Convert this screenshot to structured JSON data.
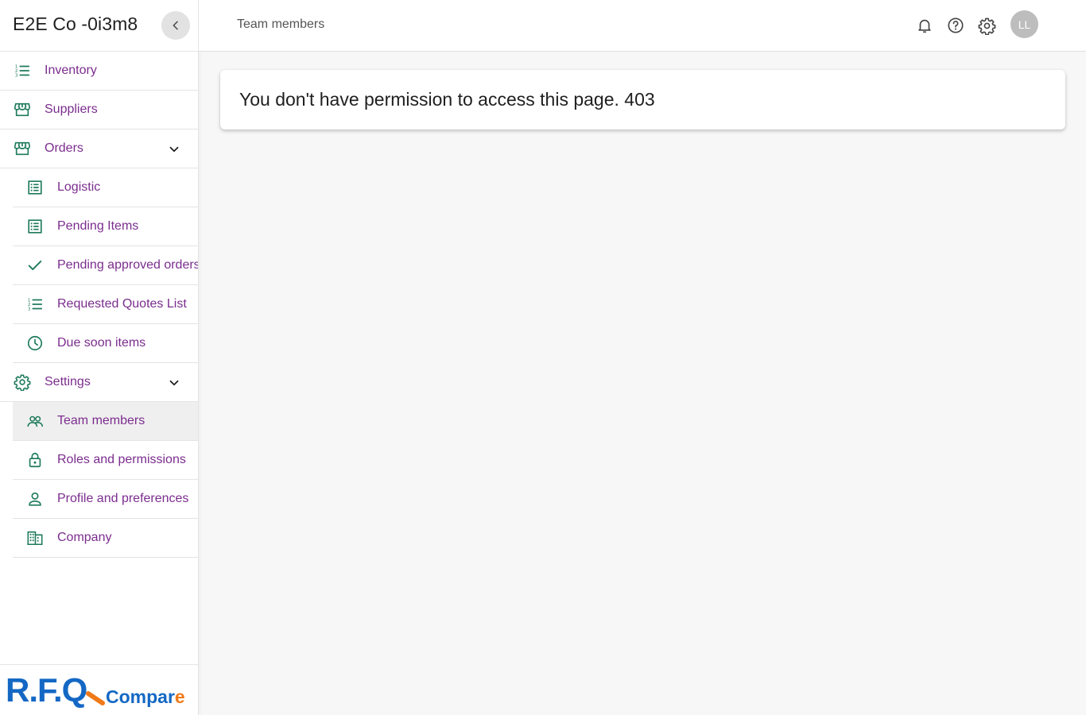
{
  "sidebar": {
    "company_name": "E2E Co -0i3m8",
    "items": [
      {
        "label": "Inventory",
        "icon": "list-numbered-icon"
      },
      {
        "label": "Suppliers",
        "icon": "storefront-icon"
      },
      {
        "label": "Orders",
        "icon": "storefront-icon",
        "expanded": true
      },
      {
        "label": "Logistic",
        "icon": "receipt-list-icon"
      },
      {
        "label": "Pending Items",
        "icon": "receipt-list-icon"
      },
      {
        "label": "Pending approved orders",
        "icon": "check-icon"
      },
      {
        "label": "Requested Quotes List",
        "icon": "list-numbered-icon"
      },
      {
        "label": "Due soon items",
        "icon": "clock-icon"
      },
      {
        "label": "Settings",
        "icon": "gear-icon",
        "expanded": true
      },
      {
        "label": "Team members",
        "icon": "people-icon",
        "active": true
      },
      {
        "label": "Roles and permissions",
        "icon": "lock-icon"
      },
      {
        "label": "Profile and preferences",
        "icon": "person-icon"
      },
      {
        "label": "Company",
        "icon": "building-icon"
      }
    ],
    "logo": {
      "main": "R.F.Q",
      "sub": "Compare"
    }
  },
  "header": {
    "title": "Team members",
    "avatar_initials": "LL"
  },
  "main": {
    "message": "You don't have permission to access this page. 403"
  },
  "colors": {
    "accent": "#7b2d8e",
    "icon": "#1e7a5c",
    "logo_blue": "#1468c4",
    "logo_orange": "#f07a1a"
  }
}
